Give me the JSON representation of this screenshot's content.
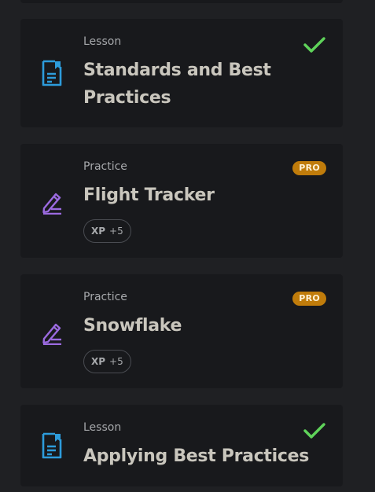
{
  "colors": {
    "background": "#1f2023",
    "card": "#18191c",
    "lesson_icon": "#2d9cdb",
    "practice_icon": "#9b6ae0",
    "check": "#5fd35a",
    "pro_badge": "#c07c0b"
  },
  "items": [
    {
      "kind": "Lesson",
      "title": "Standards and Best Practices",
      "icon": "lesson-document-icon",
      "status": "completed",
      "status_icon": "checkmark-icon"
    },
    {
      "kind": "Practice",
      "title": "Flight Tracker",
      "icon": "practice-pencil-icon",
      "badge": "PRO",
      "xp_label": "XP",
      "xp_value": "+5"
    },
    {
      "kind": "Practice",
      "title": "Snowflake",
      "icon": "practice-pencil-icon",
      "badge": "PRO",
      "xp_label": "XP",
      "xp_value": "+5"
    },
    {
      "kind": "Lesson",
      "title": "Applying Best Practices",
      "icon": "lesson-document-icon",
      "status": "completed",
      "status_icon": "checkmark-icon"
    }
  ]
}
